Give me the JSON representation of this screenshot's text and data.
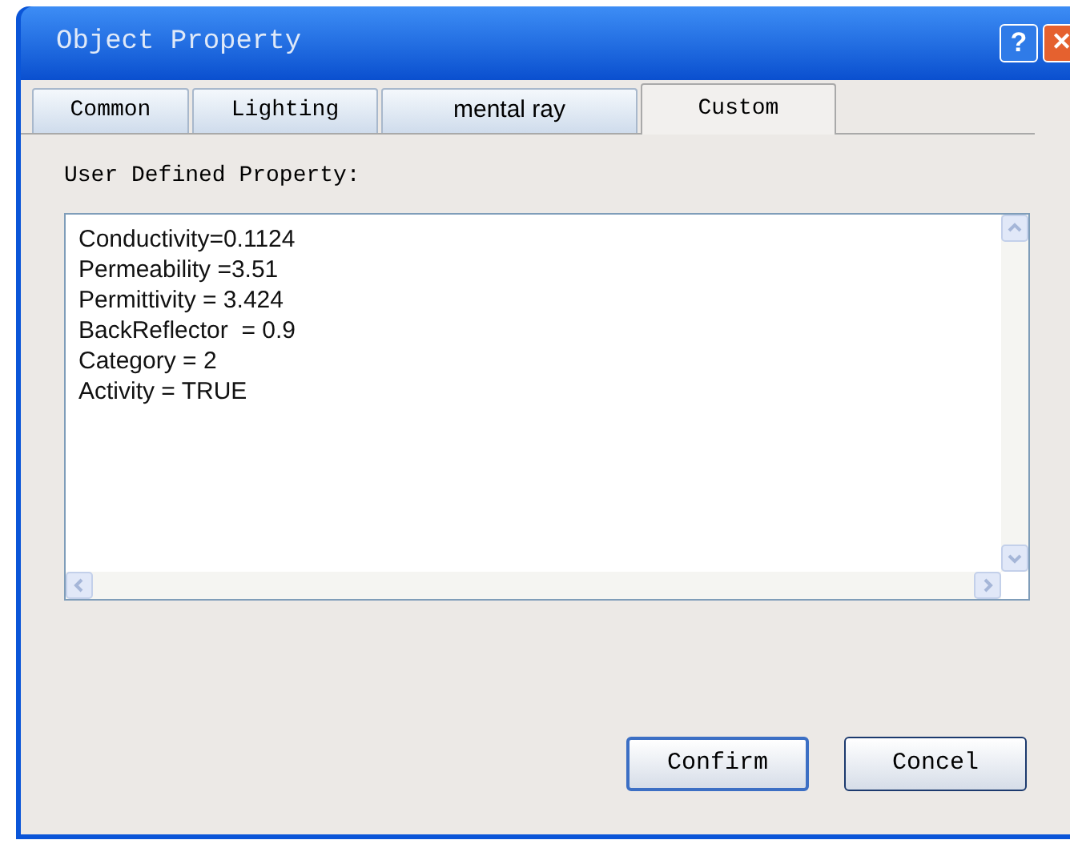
{
  "window": {
    "title": "Object Property",
    "buttons": [
      "?",
      "✕"
    ]
  },
  "tabs": [
    {
      "label": "Common",
      "selected": false
    },
    {
      "label": "Lighting",
      "selected": false
    },
    {
      "label": "mental ray",
      "selected": false
    },
    {
      "label": "Custom",
      "selected": true
    }
  ],
  "field_label": "User Defined Property:",
  "text_area": {
    "lines": [
      "Conductivity=0.1124",
      "Permeability =3.51",
      "Permittivity = 3.424",
      "BackReflector  = 0.9",
      "Category = 2",
      "Activity = TRUE"
    ]
  },
  "buttons": [
    {
      "label": "Confirm",
      "selected": true
    },
    {
      "label": "Concel",
      "selected": false
    }
  ]
}
